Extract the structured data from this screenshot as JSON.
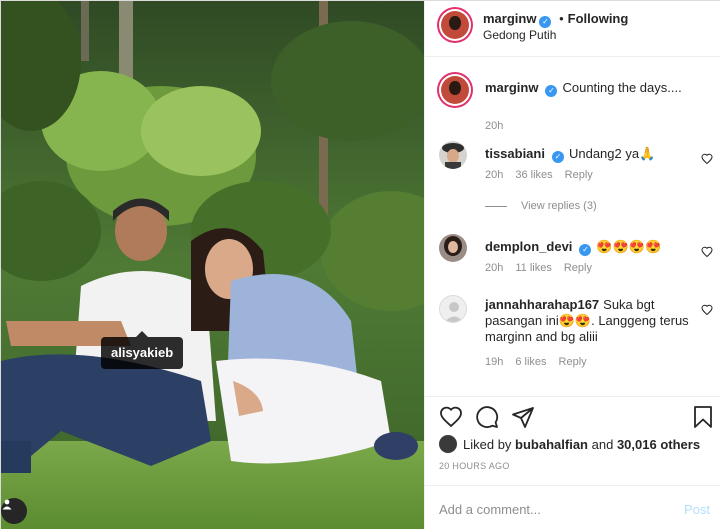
{
  "post": {
    "username": "marginw",
    "follow_separator": "•",
    "follow_status": "Following",
    "location": "Gedong Putih",
    "photo_tag": "alisyakieb"
  },
  "caption": {
    "username": "marginw",
    "text": "Counting the days....",
    "time": "20h"
  },
  "comments": [
    {
      "username": "tissabiani",
      "text": "Undang2 ya🙏",
      "time": "20h",
      "likes": "36 likes",
      "reply": "Reply",
      "view_replies": "View replies (3)"
    },
    {
      "username": "demplon_devi",
      "text": "😍😍😍😍",
      "time": "20h",
      "likes": "11 likes",
      "reply": "Reply"
    },
    {
      "username": "jannahharahap167",
      "text": "Suka bgt pasangan ini😍😍. Langgeng terus marginn and bg aliii",
      "time": "19h",
      "likes": "6 likes",
      "reply": "Reply"
    }
  ],
  "actions": {
    "liked_prefix": "Liked by",
    "liked_user": "bubahalfian",
    "liked_and": "and",
    "liked_count": "30,016 others",
    "timestamp": "20 HOURS AGO"
  },
  "add_comment": {
    "placeholder": "Add a comment...",
    "post_label": "Post"
  },
  "colors": {
    "verified": "#3897f0",
    "story_ring": "#e1306c",
    "post_disabled": "#b2dffc",
    "muted": "#8e8e8e"
  },
  "icons": [
    "verified-badge-icon",
    "heart-icon",
    "comment-icon",
    "share-icon",
    "bookmark-icon",
    "user-tag-icon"
  ]
}
